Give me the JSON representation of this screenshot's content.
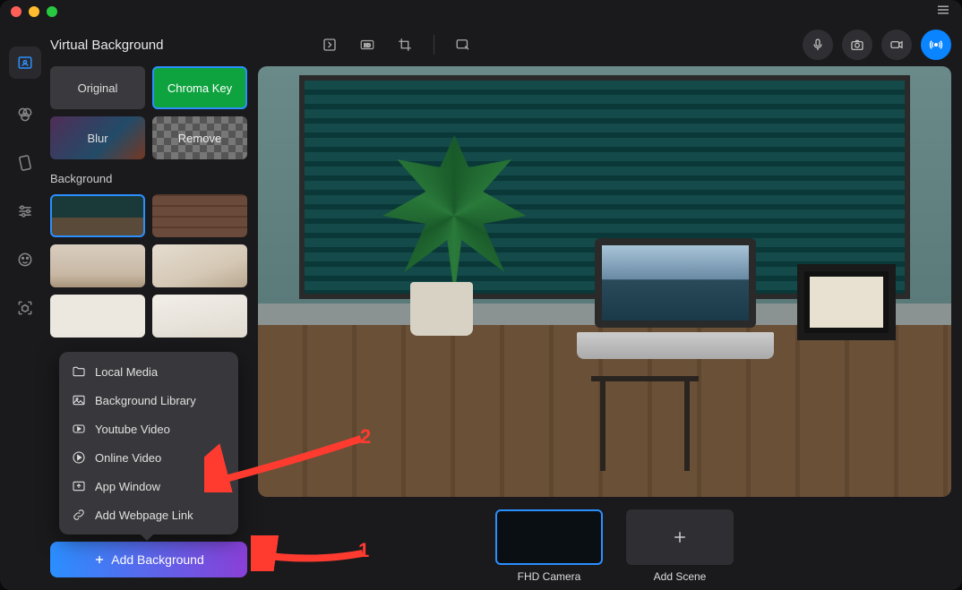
{
  "window": {
    "title": "Virtual Background"
  },
  "effects": {
    "original": "Original",
    "chroma": "Chroma Key",
    "blur": "Blur",
    "remove": "Remove"
  },
  "section": {
    "background_label": "Background"
  },
  "menu": {
    "local_media": "Local Media",
    "background_library": "Background Library",
    "youtube_video": "Youtube Video",
    "online_video": "Online Video",
    "app_window": "App Window",
    "add_webpage_link": "Add Webpage Link"
  },
  "add_bg_button": "Add Background",
  "scenes": {
    "camera": "FHD Camera",
    "add": "Add Scene"
  },
  "annotations": {
    "one": "1",
    "two": "2"
  },
  "colors": {
    "accent": "#2b8fff",
    "danger": "#ff3b30"
  }
}
